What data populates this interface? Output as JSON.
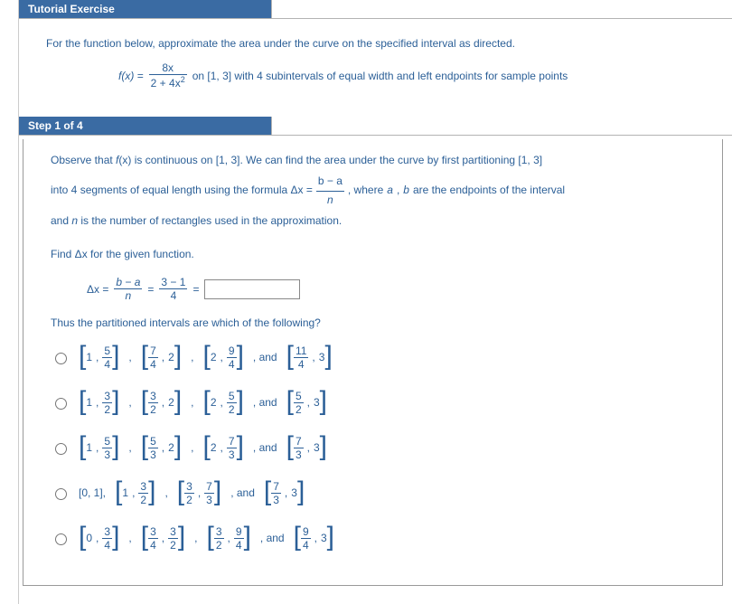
{
  "headers": {
    "tutorial": "Tutorial Exercise",
    "step": "Step 1 of 4"
  },
  "problem": {
    "intro": "For the function below, approximate the area under the curve on the specified interval as directed.",
    "fx_label": "f(x) =",
    "fn_num": "8x",
    "fn_den": "2 + 4x",
    "fn_den_exp": "2",
    "tail": "on [1, 3] with 4 subintervals of equal width and left endpoints for sample points"
  },
  "step": {
    "observe1": "Observe that ",
    "fxital": "f",
    "obs_paren": "(x)",
    "observe2": " is continuous on [1, 3]. We can find the area under the curve by first partitioning [1, 3]",
    "line2a": "into 4 segments of equal length using the formula Δx = ",
    "ba_num": "b − a",
    "ba_den": "n",
    "line2b": ", where ",
    "a_it": "a",
    "comma_sep": ", ",
    "b_it": "b",
    "line2c": " are the endpoints of the interval",
    "line3": "and ",
    "n_it": "n",
    "line3b": " is the number of rectangles used in the approximation.",
    "find": "Find Δx for the given function.",
    "dx_label": "Δx =",
    "eq": "=",
    "num31": "3 − 1",
    "den4": "4",
    "thus": "Thus the partitioned intervals are which of the following?",
    "and": "and",
    "options": [
      {
        "pairs": [
          {
            "l": "[",
            "a": "1",
            "b": {
              "n": "5",
              "d": "4"
            },
            "r": "]"
          },
          {
            "l": "[",
            "a": {
              "n": "7",
              "d": "4"
            },
            "b": "2",
            "r": "]"
          },
          {
            "l": "[",
            "a": "2",
            "b": {
              "n": "9",
              "d": "4"
            },
            "r": "]"
          },
          {
            "l": "[",
            "a": {
              "n": "11",
              "d": "4"
            },
            "b": "3",
            "r": "]"
          }
        ]
      },
      {
        "pairs": [
          {
            "l": "[",
            "a": "1",
            "b": {
              "n": "3",
              "d": "2"
            },
            "r": "]"
          },
          {
            "l": "[",
            "a": {
              "n": "3",
              "d": "2"
            },
            "b": "2",
            "r": "]"
          },
          {
            "l": "[",
            "a": "2",
            "b": {
              "n": "5",
              "d": "2"
            },
            "r": "]"
          },
          {
            "l": "[",
            "a": {
              "n": "5",
              "d": "2"
            },
            "b": "3",
            "r": "]"
          }
        ]
      },
      {
        "pairs": [
          {
            "l": "[",
            "a": "1",
            "b": {
              "n": "5",
              "d": "3"
            },
            "r": "]"
          },
          {
            "l": "[",
            "a": {
              "n": "5",
              "d": "3"
            },
            "b": "2",
            "r": "]"
          },
          {
            "l": "[",
            "a": "2",
            "b": {
              "n": "7",
              "d": "3"
            },
            "r": "]"
          },
          {
            "l": "[",
            "a": {
              "n": "7",
              "d": "3"
            },
            "b": "3",
            "r": "]"
          }
        ]
      },
      {
        "plain": "[0, 1],",
        "pairs": [
          {
            "l": "[",
            "a": "1",
            "b": {
              "n": "3",
              "d": "2"
            },
            "r": "]"
          },
          {
            "l": "[",
            "a": {
              "n": "3",
              "d": "2"
            },
            "b": {
              "n": "7",
              "d": "3"
            },
            "r": "]"
          },
          {
            "l": "[",
            "a": {
              "n": "7",
              "d": "3"
            },
            "b": "3",
            "r": "]"
          }
        ]
      },
      {
        "pairs": [
          {
            "l": "[",
            "a": "0",
            "b": {
              "n": "3",
              "d": "4"
            },
            "r": "]"
          },
          {
            "l": "[",
            "a": {
              "n": "3",
              "d": "4"
            },
            "b": {
              "n": "3",
              "d": "2"
            },
            "r": "]"
          },
          {
            "l": "[",
            "a": {
              "n": "3",
              "d": "2"
            },
            "b": {
              "n": "9",
              "d": "4"
            },
            "r": "]"
          },
          {
            "l": "[",
            "a": {
              "n": "9",
              "d": "4"
            },
            "b": "3",
            "r": "]"
          }
        ]
      }
    ]
  }
}
